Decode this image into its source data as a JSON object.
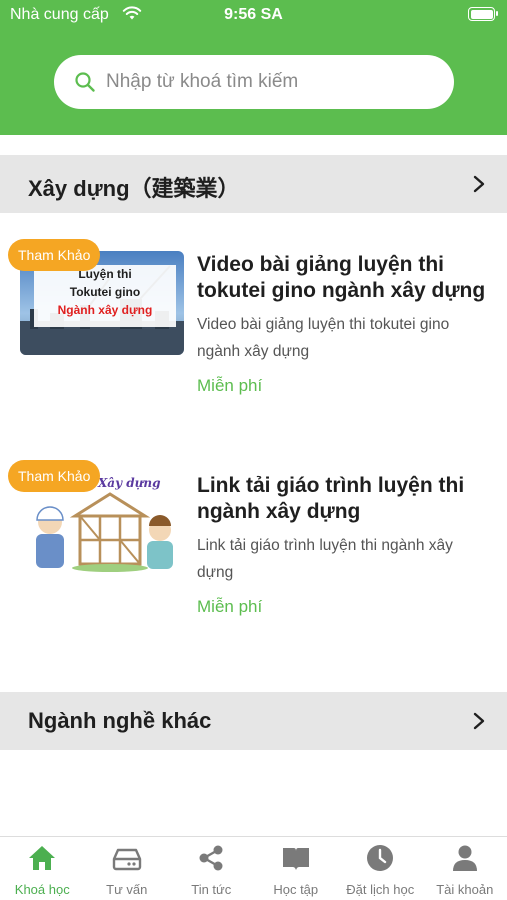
{
  "status_bar": {
    "carrier": "Nhà cung cấp",
    "time": "9:56 SA"
  },
  "search": {
    "placeholder": "Nhập từ khoá tìm kiếm"
  },
  "sections": [
    {
      "title": "Xây dựng（建築業）",
      "courses": [
        {
          "badge": "Tham Khảo",
          "thumb_lines": [
            "Luyện thi",
            "Tokutei gino",
            "Ngành xây dựng"
          ],
          "title": "Video bài giảng luyện thi tokutei gino ngành xây dựng",
          "description": "Video bài giảng luyện thi tokutei gino ngành xây dựng",
          "price": "Miễn phí"
        },
        {
          "badge": "Tham Khảo",
          "thumb_caption": "Xây dựng",
          "title": "Link tải giáo trình luyện thi ngành xây dựng",
          "description": "Link tải giáo trình luyện thi ngành xây dựng",
          "price": "Miễn phí"
        }
      ]
    },
    {
      "title": "Ngành nghề khác"
    }
  ],
  "tabbar": [
    {
      "label": "Khoá học",
      "icon": "home-icon",
      "active": true
    },
    {
      "label": "Tư vấn",
      "icon": "inbox-icon"
    },
    {
      "label": "Tin tức",
      "icon": "share-icon"
    },
    {
      "label": "Học tập",
      "icon": "book-icon"
    },
    {
      "label": "Đặt lịch học",
      "icon": "clock-icon"
    },
    {
      "label": "Tài khoản",
      "icon": "user-icon"
    }
  ],
  "colors": {
    "brand_green": "#5cbd4f",
    "badge_orange": "#f5a623",
    "section_bg": "#e6e6e6"
  }
}
